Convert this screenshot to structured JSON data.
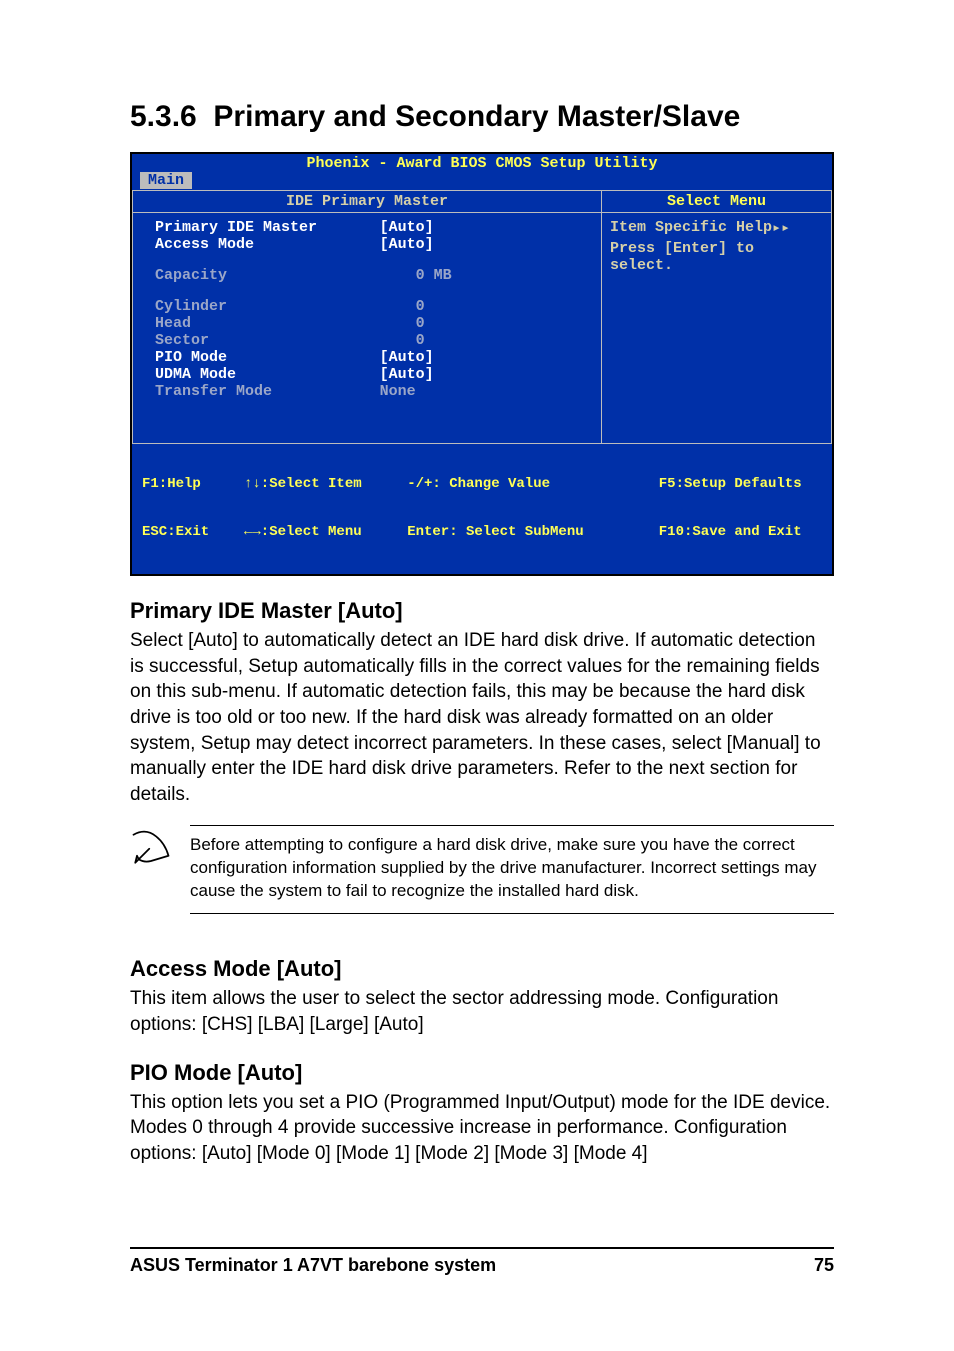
{
  "section": {
    "number": "5.3.6",
    "title": "Primary and Secondary Master/Slave"
  },
  "bios": {
    "utility_title": "Phoenix - Award BIOS CMOS Setup Utility",
    "tab": "Main",
    "left_header": "IDE Primary Master",
    "right_header": "Select Menu",
    "help_title": "Item Specific Help",
    "help_body": "Press [Enter] to select.",
    "rows": [
      {
        "k": "Primary IDE Master",
        "v": "[Auto]",
        "cls": "white"
      },
      {
        "k": "Access Mode",
        "v": "[Auto]",
        "cls": "white"
      },
      {
        "k": "",
        "v": "",
        "cls": "spacer"
      },
      {
        "k": "Capacity",
        "v": "    0 MB",
        "cls": "grey"
      },
      {
        "k": "",
        "v": "",
        "cls": "spacer"
      },
      {
        "k": "Cylinder",
        "v": "    0",
        "cls": "grey"
      },
      {
        "k": "Head",
        "v": "    0",
        "cls": "grey"
      },
      {
        "k": "Sector",
        "v": "    0",
        "cls": "grey"
      },
      {
        "k": "PIO Mode",
        "v": "[Auto]",
        "cls": "white"
      },
      {
        "k": "UDMA Mode",
        "v": "[Auto]",
        "cls": "white"
      },
      {
        "k": "Transfer Mode",
        "v": "None",
        "cls": "grey"
      }
    ],
    "footer": {
      "c1a": "F1:Help",
      "c2a": "↑↓:Select Item",
      "c3a": "-/+: Change Value",
      "c4a": "F5:Setup Defaults",
      "c1b": "ESC:Exit",
      "c2b": "←→:Select Menu",
      "c3b": "Enter: Select SubMenu",
      "c4b": "F10:Save and Exit"
    }
  },
  "sections": {
    "primary": {
      "heading": "Primary IDE Master [Auto]",
      "body": "Select [Auto] to automatically detect an IDE hard disk drive. If automatic detection is successful, Setup automatically fills in the correct values for the remaining fields on this sub-menu. If automatic detection fails, this may be because the hard disk drive is too old or too new. If the hard disk was already formatted on an older system, Setup may detect incorrect parameters. In these cases, select [Manual] to manually enter the IDE hard disk drive parameters. Refer to the next section for details."
    },
    "note": "Before attempting to configure a hard disk drive, make sure you have the correct configuration information supplied by the drive manufacturer. Incorrect settings may cause the system to fail to recognize the installed hard disk.",
    "access": {
      "heading": "Access Mode [Auto]",
      "body": "This item allows the user to select the sector addressing mode. Configuration options: [CHS] [LBA] [Large] [Auto]"
    },
    "pio": {
      "heading": "PIO Mode [Auto]",
      "body": "This option lets you set a PIO (Programmed Input/Output) mode for the IDE device. Modes 0 through 4 provide successive increase in performance. Configuration options: [Auto] [Mode 0] [Mode 1] [Mode 2] [Mode 3] [Mode 4]"
    }
  },
  "footer": {
    "left": "ASUS Terminator 1 A7VT barebone system",
    "right": "75"
  }
}
